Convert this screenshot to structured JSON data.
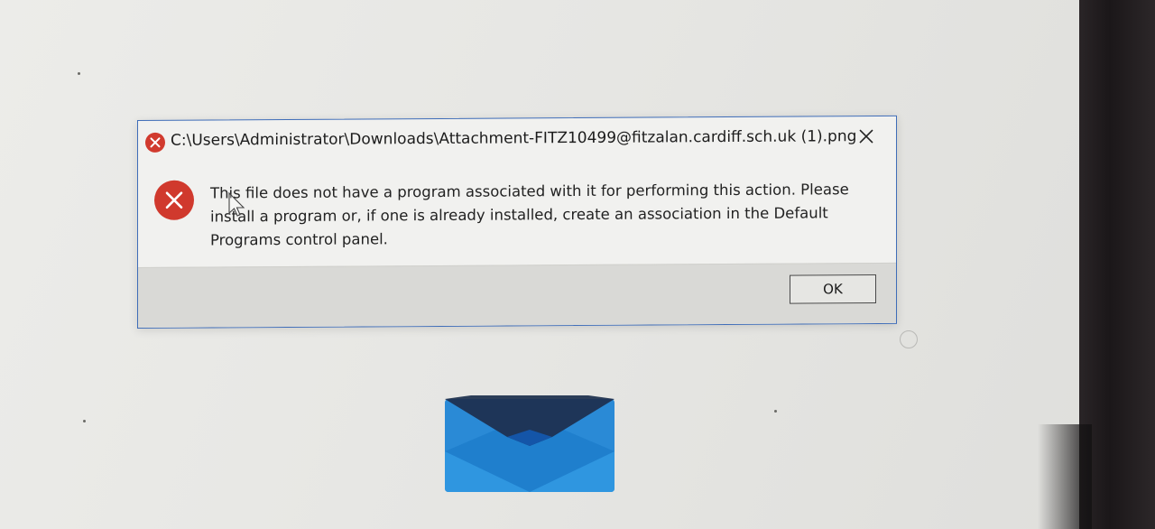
{
  "dialog": {
    "title": "C:\\Users\\Administrator\\Downloads\\Attachment-FITZ10499@fitzalan.cardiff.sch.uk (1).png",
    "message": "This file does not have a program associated with it for performing this action. Please install a program or, if one is already installed, create an association in the Default Programs control panel.",
    "ok_label": "OK",
    "close_glyph": "✕"
  },
  "icons": {
    "title": "error-icon",
    "body": "error-icon",
    "close": "close-icon",
    "background": "mail-envelope-icon"
  },
  "colors": {
    "error_red": "#d0392d",
    "dialog_border": "#3f6db8",
    "envelope_light": "#2a8ad6",
    "envelope_dark": "#1e3558"
  }
}
